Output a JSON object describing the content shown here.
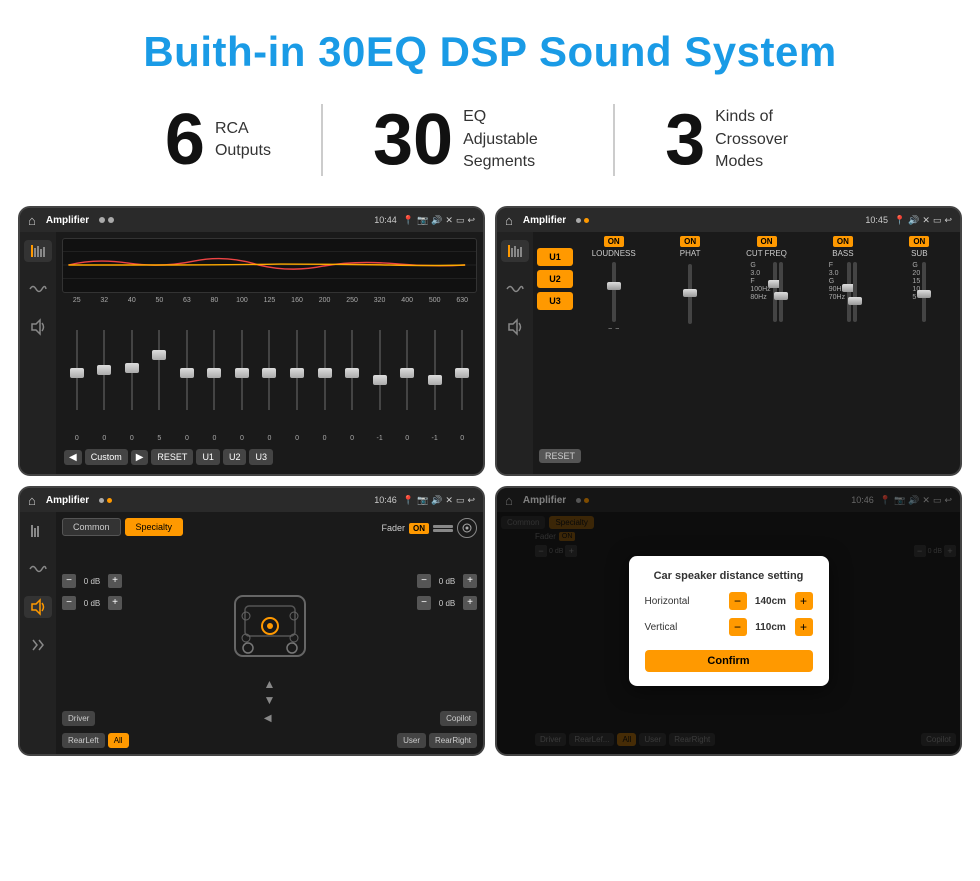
{
  "page": {
    "title": "Buith-in 30EQ DSP Sound System",
    "stats": [
      {
        "number": "6",
        "line1": "RCA",
        "line2": "Outputs"
      },
      {
        "number": "30",
        "line1": "EQ Adjustable",
        "line2": "Segments"
      },
      {
        "number": "3",
        "line1": "Kinds of",
        "line2": "Crossover Modes"
      }
    ]
  },
  "screen_eq": {
    "status": {
      "home": "⌂",
      "title": "Amplifier",
      "time": "10:44",
      "icon_location": "📍",
      "icon_camera": "📷",
      "icon_sound": "🔊",
      "icon_close": "✕",
      "icon_window": "▭",
      "icon_back": "↩"
    },
    "freq_labels": [
      "25",
      "32",
      "40",
      "50",
      "63",
      "80",
      "100",
      "125",
      "160",
      "200",
      "250",
      "320",
      "400",
      "500",
      "630"
    ],
    "slider_values": [
      "0",
      "0",
      "0",
      "5",
      "0",
      "0",
      "0",
      "0",
      "0",
      "0",
      "0",
      "-1",
      "0",
      "-1"
    ],
    "buttons": [
      "◀",
      "Custom",
      "▶",
      "RESET",
      "U1",
      "U2",
      "U3"
    ]
  },
  "screen_dsp": {
    "status": {
      "title": "Amplifier",
      "time": "10:45"
    },
    "presets": [
      "U1",
      "U2",
      "U3"
    ],
    "controls": [
      {
        "label": "LOUDNESS",
        "on": true
      },
      {
        "label": "PHAT",
        "on": true
      },
      {
        "label": "CUT FREQ",
        "on": true
      },
      {
        "label": "BASS",
        "on": true
      },
      {
        "label": "SUB",
        "on": true
      }
    ],
    "reset_label": "RESET",
    "on_label": "ON"
  },
  "screen_crossover": {
    "status": {
      "title": "Amplifier",
      "time": "10:46"
    },
    "tabs": [
      "Common",
      "Specialty"
    ],
    "fader_label": "Fader",
    "on_label": "ON",
    "db_values": [
      "0 dB",
      "0 dB",
      "0 dB",
      "0 dB"
    ],
    "bottom_buttons": [
      "Driver",
      "RearLeft",
      "All",
      "User",
      "RearRight",
      "Copilot"
    ]
  },
  "screen_dialog": {
    "status": {
      "title": "Amplifier",
      "time": "10:46"
    },
    "tabs": [
      "Common",
      "Specialty"
    ],
    "dialog": {
      "title": "Car speaker distance setting",
      "horizontal_label": "Horizontal",
      "horizontal_value": "140cm",
      "vertical_label": "Vertical",
      "vertical_value": "110cm",
      "confirm_label": "Confirm",
      "minus": "−",
      "plus": "+"
    },
    "db_values": [
      "0 dB",
      "0 dB"
    ],
    "bottom_buttons": [
      "Driver",
      "RearLef...",
      "All",
      "User",
      "RearRight",
      "Copilot"
    ]
  }
}
